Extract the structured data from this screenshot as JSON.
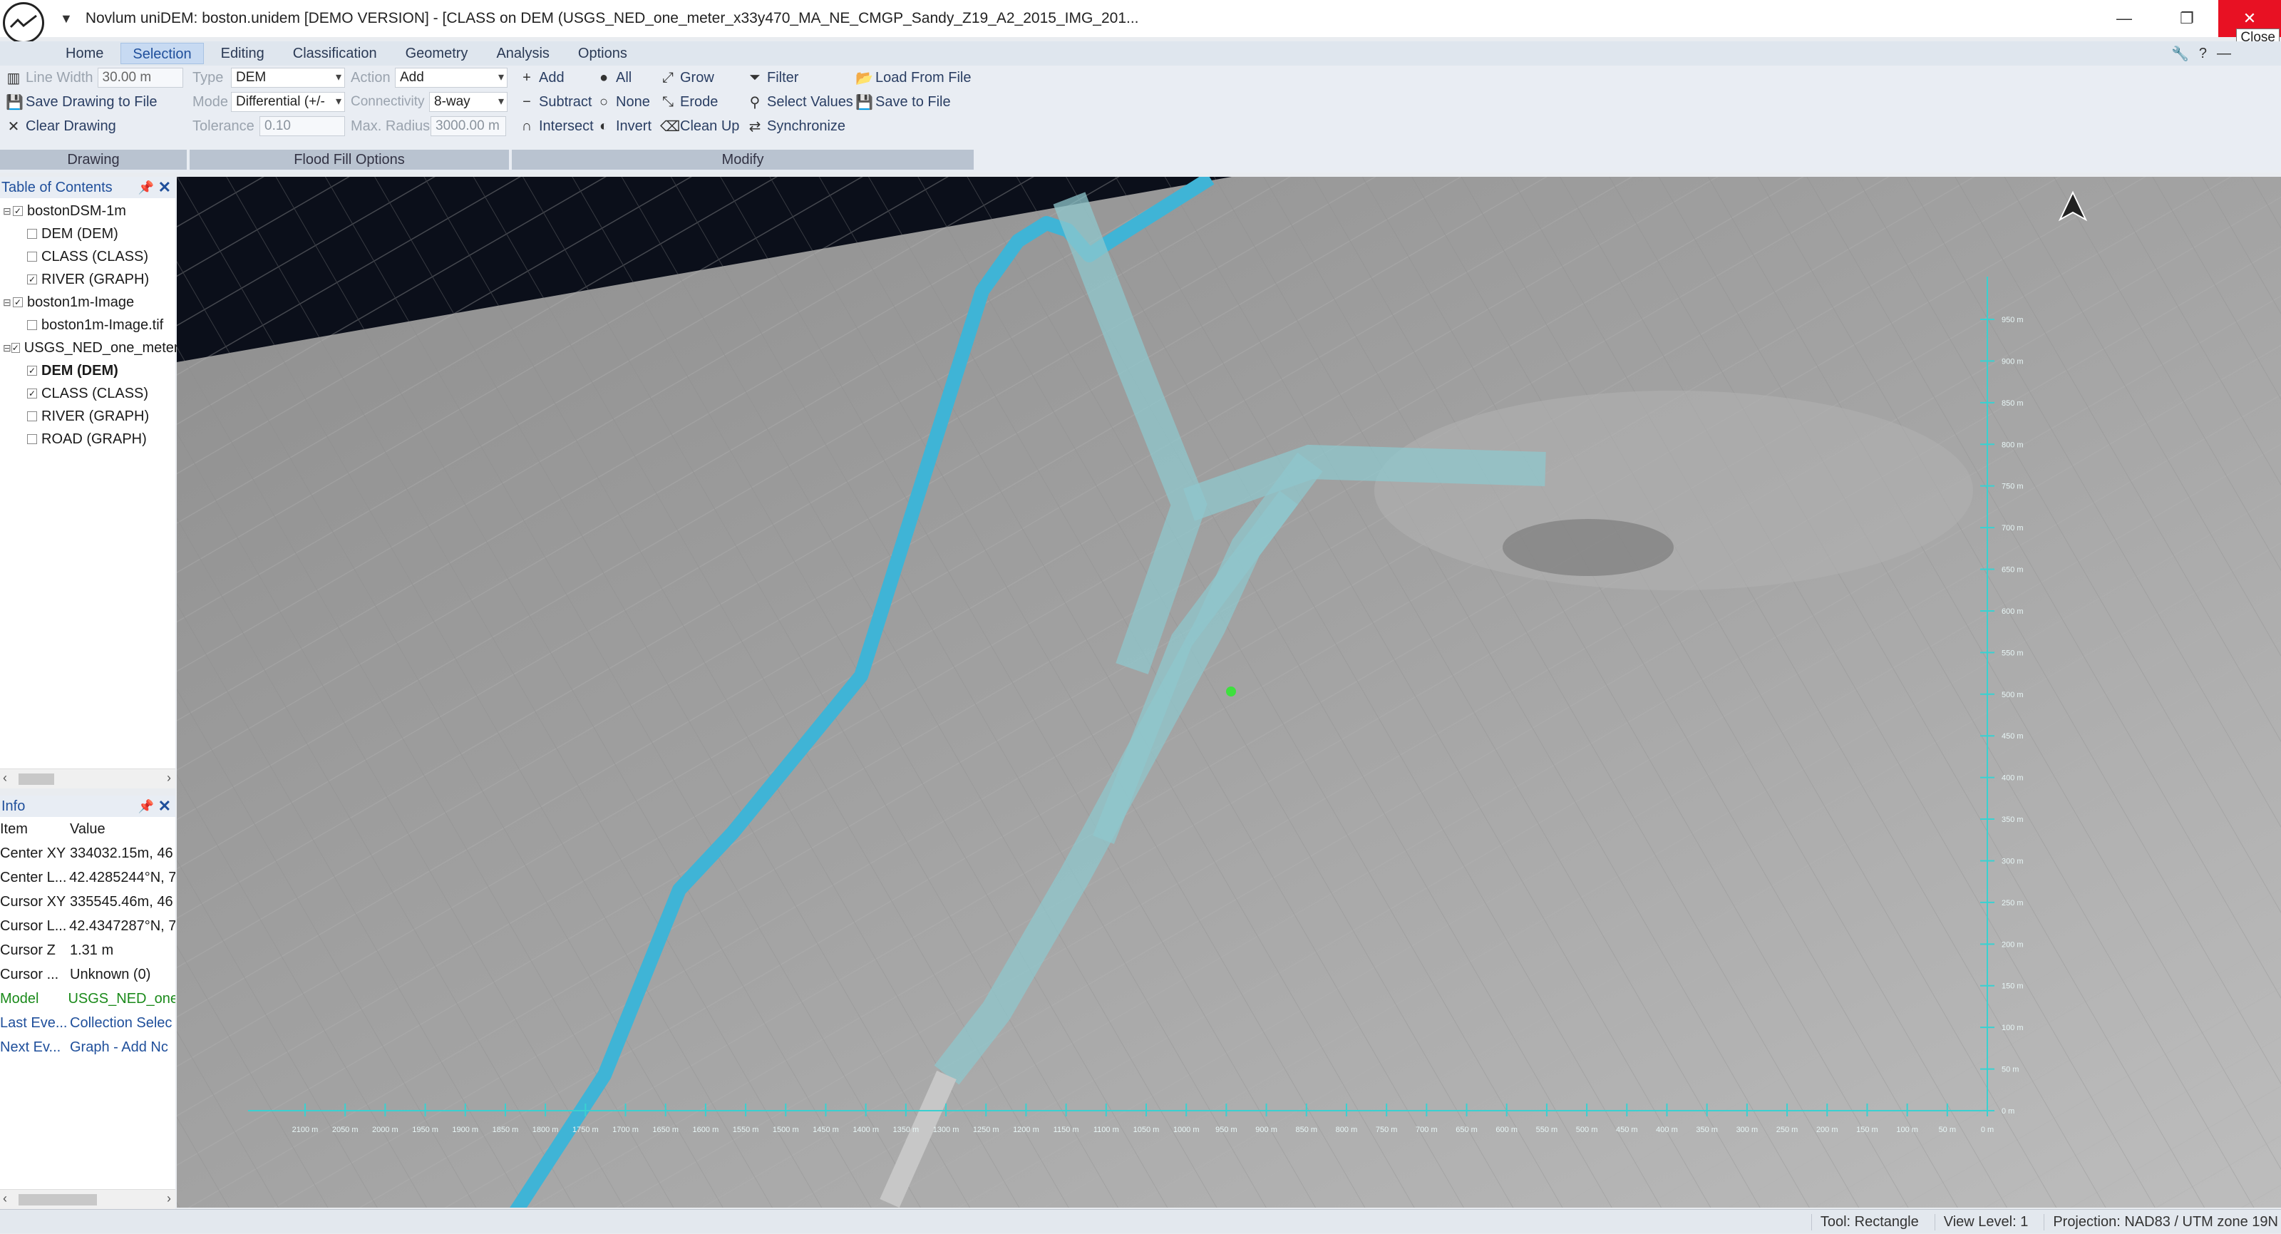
{
  "window": {
    "title": "Novlum uniDEM: boston.unidem [DEMO VERSION] - [CLASS on DEM (USGS_NED_one_meter_x33y470_MA_NE_CMGP_Sandy_Z19_A2_2015_IMG_201...",
    "close_tooltip": "Close"
  },
  "menu": {
    "tabs": [
      "Home",
      "Selection",
      "Editing",
      "Classification",
      "Geometry",
      "Analysis",
      "Options"
    ],
    "active": "Selection"
  },
  "ribbon": {
    "drawing": {
      "line_width_label": "Line Width",
      "line_width_value": "30.00 m",
      "save_drawing": "Save Drawing to File",
      "clear_drawing": "Clear Drawing",
      "footer": "Drawing"
    },
    "flood_fill": {
      "type_label": "Type",
      "type_value": "DEM",
      "action_label": "Action",
      "action_value": "Add",
      "mode_label": "Mode",
      "mode_value": "Differential (+/-",
      "connectivity_label": "Connectivity",
      "connectivity_value": "8-way",
      "tolerance_label": "Tolerance",
      "tolerance_value": "0.10",
      "max_radius_label": "Max. Radius",
      "max_radius_value": "3000.00 m",
      "footer": "Flood Fill Options"
    },
    "modify": {
      "add": "Add",
      "subtract": "Subtract",
      "intersect": "Intersect",
      "all": "All",
      "none": "None",
      "invert": "Invert",
      "grow": "Grow",
      "erode": "Erode",
      "clean_up": "Clean Up",
      "filter": "Filter",
      "select_values": "Select Values",
      "synchronize": "Synchronize",
      "load_from_file": "Load From File",
      "save_to_file": "Save to File",
      "footer": "Modify"
    }
  },
  "toc": {
    "title": "Table of Contents",
    "items": [
      {
        "label": "bostonDSM-1m",
        "level": 0,
        "checked": true
      },
      {
        "label": "DEM (DEM)",
        "level": 1,
        "checked": false
      },
      {
        "label": "CLASS (CLASS)",
        "level": 1,
        "checked": false
      },
      {
        "label": "RIVER (GRAPH)",
        "level": 1,
        "checked": true
      },
      {
        "label": "boston1m-Image",
        "level": 0,
        "checked": true
      },
      {
        "label": "boston1m-Image.tif",
        "level": 1,
        "checked": false
      },
      {
        "label": "USGS_NED_one_meter",
        "level": 0,
        "checked": true
      },
      {
        "label": "DEM (DEM)",
        "level": 1,
        "checked": true,
        "bold": true
      },
      {
        "label": "CLASS (CLASS)",
        "level": 1,
        "checked": true
      },
      {
        "label": "RIVER (GRAPH)",
        "level": 1,
        "checked": false
      },
      {
        "label": "ROAD (GRAPH)",
        "level": 1,
        "checked": false
      }
    ]
  },
  "info": {
    "title": "Info",
    "col_item": "Item",
    "col_value": "Value",
    "rows": [
      {
        "k": "Center XY",
        "v": "334032.15m, 46"
      },
      {
        "k": "Center L...",
        "v": "42.4285244°N, 7"
      },
      {
        "k": "Cursor XY",
        "v": "335545.46m, 46"
      },
      {
        "k": "Cursor L...",
        "v": "42.4347287°N, 7"
      },
      {
        "k": "Cursor Z",
        "v": "1.31 m"
      },
      {
        "k": "Cursor ...",
        "v": "Unknown (0)"
      },
      {
        "k": "Model",
        "v": "USGS_NED_one"
      },
      {
        "k": "Last Eve...",
        "v": "Collection Selec"
      },
      {
        "k": "Next Ev...",
        "v": "Graph - Add Nc"
      }
    ]
  },
  "map": {
    "x_ticks": [
      "2100 m",
      "2050 m",
      "2000 m",
      "1950 m",
      "1900 m",
      "1850 m",
      "1800 m",
      "1750 m",
      "1700 m",
      "1650 m",
      "1600 m",
      "1550 m",
      "1500 m",
      "1450 m",
      "1400 m",
      "1350 m",
      "1300 m",
      "1250 m",
      "1200 m",
      "1150 m",
      "1100 m",
      "1050 m",
      "1000 m",
      "950 m",
      "900 m",
      "850 m",
      "800 m",
      "750 m",
      "700 m",
      "650 m",
      "600 m",
      "550 m",
      "500 m",
      "450 m",
      "400 m",
      "350 m",
      "300 m",
      "250 m",
      "200 m",
      "150 m",
      "100 m",
      "50 m",
      "0 m"
    ],
    "y_ticks": [
      "950 m",
      "900 m",
      "850 m",
      "800 m",
      "750 m",
      "700 m",
      "650 m",
      "600 m",
      "550 m",
      "500 m",
      "450 m",
      "400 m",
      "350 m",
      "300 m",
      "250 m",
      "200 m",
      "150 m",
      "100 m",
      "50 m",
      "0 m"
    ]
  },
  "status": {
    "tool": "Tool: Rectangle",
    "view_level": "View Level: 1",
    "projection": "Projection: NAD83 / UTM zone 19N"
  },
  "colors": {
    "river": "#3fb4d6",
    "selection": "#8fc7cc",
    "axis": "#39d1d1",
    "accent": "#1f4f9b"
  }
}
